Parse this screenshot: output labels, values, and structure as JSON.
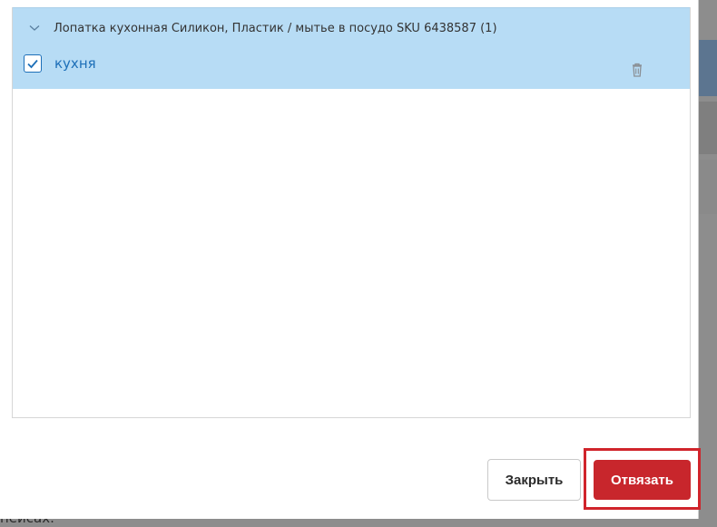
{
  "background": {
    "partial_text": "пейсах."
  },
  "modal": {
    "group": {
      "title": "Лопатка кухонная Силикон, Пластик / мытье в посудо SKU 6438587 (1)",
      "expanded": true,
      "items": [
        {
          "label": "кухня",
          "checked": true
        }
      ]
    },
    "footer": {
      "close_label": "Закрыть",
      "unlink_label": "Отвязать"
    }
  },
  "colors": {
    "accent": "#1d6fb8",
    "selected_row_bg": "#b7dcf5",
    "danger": "#c8262c"
  }
}
